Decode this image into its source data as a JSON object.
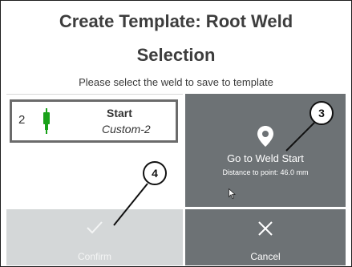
{
  "header": {
    "title_line1": "Create Template: Root Weld",
    "title_line2": "Selection",
    "subtitle": "Please select the weld to save to template"
  },
  "weld_list": {
    "items": [
      {
        "number": "2",
        "name": "Start",
        "template": "Custom-2",
        "icon": "weld-torch-icon",
        "icon_color": "#19a119"
      }
    ]
  },
  "go_to_weld": {
    "label": "Go to Weld Start",
    "distance": "Distance to point: 46.0 mm",
    "icon": "map-pin-icon"
  },
  "actions": {
    "confirm_label": "Confirm",
    "cancel_label": "Cancel",
    "confirm_enabled": false
  },
  "annotations": {
    "marker_3": "3",
    "marker_4": "4"
  },
  "colors": {
    "button_dark": "#6d7275",
    "button_disabled": "#d4d7d8",
    "weld_green": "#19a119"
  }
}
